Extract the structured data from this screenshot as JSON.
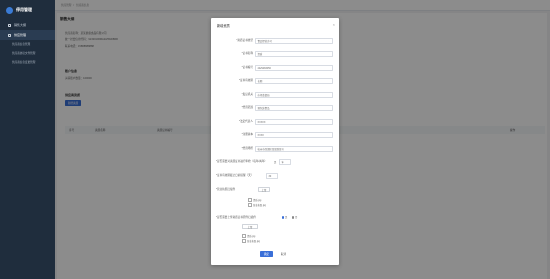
{
  "app": {
    "title": "停用管理"
  },
  "sidebar": {
    "items": [
      {
        "label": "销售大纲"
      },
      {
        "label": "供应管理"
      }
    ],
    "subitems": [
      {
        "label": "供应商信息管理"
      },
      {
        "label": "供应商协议文件管理"
      },
      {
        "label": "供应商信息变更管理"
      }
    ]
  },
  "topbar": {
    "crumbs": [
      "供应管理",
      "/",
      "供应商信息"
    ]
  },
  "content": {
    "title": "销售大纲",
    "info1": "供应商名称：某某健康食品有限公司",
    "info2": "统一社会信用代码：91330106MA2H5WDB6R",
    "info3": "联系电话：15888888888",
    "section1": "账户信息",
    "section1_detail": "关联账户数量：100000",
    "section2": "供应商资质",
    "add_button": "新增资质",
    "table_headers": [
      "序号",
      "资质名称",
      "资质证书编号",
      "有效期",
      "操作"
    ]
  },
  "modal": {
    "title": "新增资质",
    "close": "×",
    "fields": [
      {
        "label": "*资质证书类型",
        "value": "食品经营许可"
      },
      {
        "label": "*证书名称",
        "value": "资质"
      },
      {
        "label": "*证书编号",
        "value": "4429483456"
      },
      {
        "label": "*证书有效期",
        "value": "长期"
      },
      {
        "label": "*发证机关",
        "value": "市场监督局"
      },
      {
        "label": "*经营范围",
        "value": "预包装食品"
      },
      {
        "label": "*法定代表人",
        "value": "XXXXX"
      },
      {
        "label": "*注册资本",
        "value": "XXXX"
      },
      {
        "label": "*经营场所",
        "value": "杭州市西湖区某某路某号"
      }
    ],
    "extra1_label": "*是否需要对资质证书进行年检（每年/两年）",
    "extra1_value": "是",
    "extra1_unit": "年",
    "extra2_label": "*证书有效期截止日前提醒（天）",
    "extra2_value": "30",
    "upload1_label": "*营业执照扫描件",
    "upload_button": "上传",
    "upload1_files": [
      "资质.jpg",
      "营业执照.jpg"
    ],
    "radio_label": "*是否需要上传资质证书原件扫描件",
    "radio_options": [
      "是",
      "否"
    ],
    "upload2_files": [
      "资质.jpg",
      "营业执照.jpg"
    ],
    "ok": "确定",
    "cancel": "取消"
  },
  "colors": {
    "sidebar": "#1f2d3d",
    "accent": "#3a6fd8"
  }
}
